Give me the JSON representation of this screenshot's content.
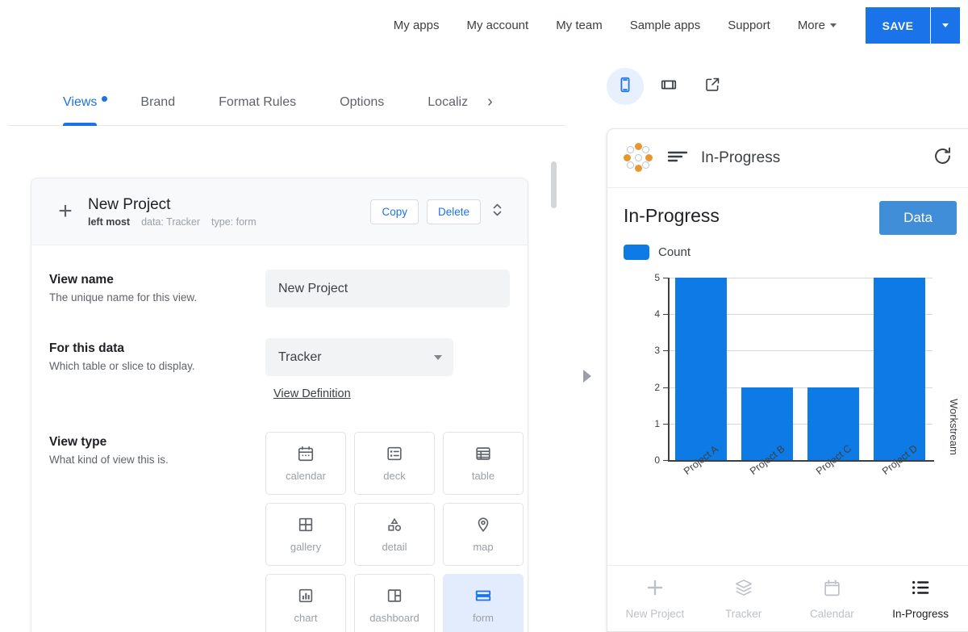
{
  "topnav": {
    "links": [
      {
        "label": "My apps",
        "icon": null
      },
      {
        "label": "My account",
        "icon": null
      },
      {
        "label": "My team",
        "icon": null
      },
      {
        "label": "Sample apps",
        "icon": null
      },
      {
        "label": "Support",
        "icon": null
      },
      {
        "label": "More",
        "icon": "chevron-down-icon"
      }
    ],
    "save_label": "SAVE",
    "save_dropdown_icon": "chevron-down-icon",
    "accent_color": "#1a73e8"
  },
  "editor": {
    "tabs": [
      {
        "label": "Views",
        "active": true,
        "dot": true
      },
      {
        "label": "Brand",
        "active": false,
        "dot": false
      },
      {
        "label": "Format Rules",
        "active": false,
        "dot": false
      },
      {
        "label": "Options",
        "active": false,
        "dot": false
      },
      {
        "label": "Localiz",
        "active": false,
        "dot": false
      }
    ],
    "tabs_next_icon": "chevron-right-icon",
    "card": {
      "add_icon": "plus-icon",
      "title": "New Project",
      "meta_position": "left most",
      "meta_data": "data: Tracker",
      "meta_type": "type: form",
      "copy_label": "Copy",
      "delete_label": "Delete",
      "reorder_icon": "up-down-chevron-icon"
    },
    "fields": {
      "view_name": {
        "title": "View name",
        "desc": "The unique name for this view.",
        "value": "New Project",
        "placeholder": "View name"
      },
      "for_this_data": {
        "title": "For this data",
        "desc": "Which table or slice to display.",
        "value": "Tracker",
        "dropdown_icon": "chevron-down-icon",
        "link_label": "View Definition"
      },
      "view_type": {
        "title": "View type",
        "desc": "What kind of view this is.",
        "options": [
          {
            "label": "calendar",
            "icon": "calendar-icon",
            "selected": false
          },
          {
            "label": "deck",
            "icon": "deck-icon",
            "selected": false
          },
          {
            "label": "table",
            "icon": "table-icon",
            "selected": false
          },
          {
            "label": "gallery",
            "icon": "gallery-icon",
            "selected": false
          },
          {
            "label": "detail",
            "icon": "detail-icon",
            "selected": false
          },
          {
            "label": "map",
            "icon": "map-pin-icon",
            "selected": false
          },
          {
            "label": "chart",
            "icon": "chart-icon",
            "selected": false
          },
          {
            "label": "dashboard",
            "icon": "dashboard-icon",
            "selected": false
          },
          {
            "label": "form",
            "icon": "form-icon",
            "selected": true
          }
        ]
      }
    },
    "expander_icon": "triangle-right-icon",
    "scrollbar_icon": "vertical-scrollbar"
  },
  "preview": {
    "device_buttons": [
      {
        "icon": "phone-icon",
        "active": true
      },
      {
        "icon": "tablet-icon",
        "active": false
      },
      {
        "icon": "external-link-icon",
        "active": false
      }
    ],
    "phone": {
      "logo_icon": "app-logo-icon",
      "menu_icon": "hamburger-menu-icon",
      "title": "In-Progress",
      "refresh_icon": "refresh-icon",
      "data_button_label": "Data",
      "data_button_color": "#3f8ed7",
      "bottom_nav": [
        {
          "label": "New Project",
          "icon": "plus-icon",
          "active": false
        },
        {
          "label": "Tracker",
          "icon": "layers-icon",
          "active": false
        },
        {
          "label": "Calendar",
          "icon": "calendar-icon",
          "active": false
        },
        {
          "label": "In-Progress",
          "icon": "list-icon",
          "active": true
        }
      ]
    }
  },
  "chart_data": {
    "type": "bar",
    "title": "In-Progress",
    "categories": [
      "Project A",
      "Project B",
      "Project C",
      "Project D"
    ],
    "values": [
      5,
      2,
      2,
      5
    ],
    "series": [
      {
        "name": "Count",
        "values": [
          5,
          2,
          2,
          5
        ]
      }
    ],
    "legend": [
      "Count"
    ],
    "legend_position": "top-left",
    "legend_color": "#0d7ae5",
    "bar_color": "#0d7ae5",
    "xlabel": "",
    "ylabel_right": "Workstream",
    "yticks": [
      0,
      1,
      2,
      3,
      4,
      5
    ],
    "ylim": [
      0,
      5
    ],
    "grid": true
  }
}
